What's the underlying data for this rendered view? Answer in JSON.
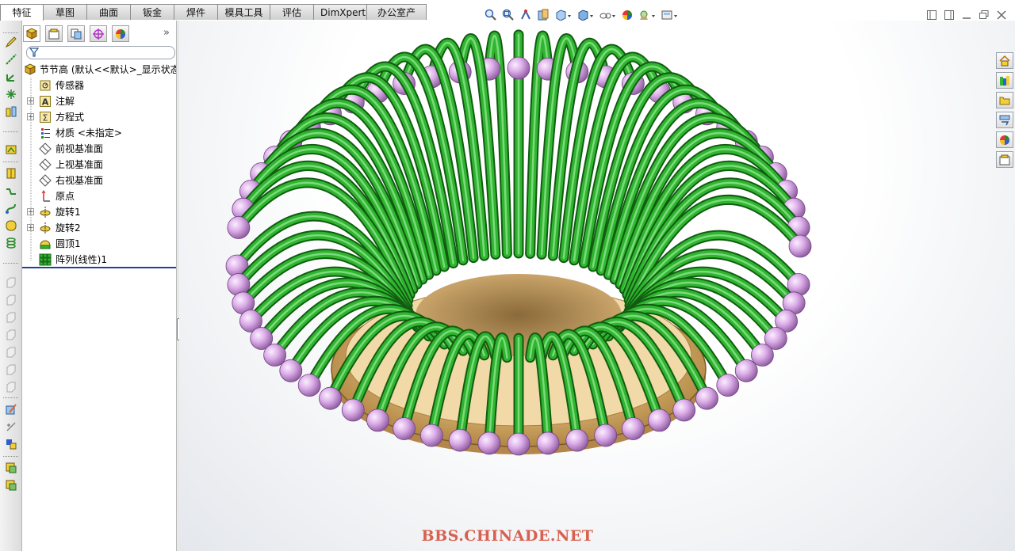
{
  "command_tabs": [
    {
      "label": "特征",
      "active": true
    },
    {
      "label": "草图",
      "active": false
    },
    {
      "label": "曲面",
      "active": false
    },
    {
      "label": "钣金",
      "active": false
    },
    {
      "label": "焊件",
      "active": false
    },
    {
      "label": "模具工具",
      "active": false
    },
    {
      "label": "评估",
      "active": false
    },
    {
      "label": "DimXpert",
      "active": false
    },
    {
      "label": "办公室产品",
      "active": false
    }
  ],
  "view_toolbar": [
    "zoom-to-fit-icon",
    "zoom-to-area-icon",
    "previous-view-icon",
    "section-view-icon",
    "view-orientation-icon",
    "display-style-icon",
    "hide-show-items-icon",
    "edit-appearance-icon",
    "apply-scene-icon",
    "view-settings-icon"
  ],
  "window_controls": {
    "minimize": "▭",
    "tile": "◫",
    "restore": "❐",
    "close": "✕"
  },
  "feature_manager": {
    "panel_tabs": [
      "feature-manager-icon",
      "property-manager-icon",
      "configuration-manager-icon",
      "dimxpert-manager-icon",
      "display-manager-icon"
    ],
    "expand_arrow": "»",
    "tree": [
      {
        "label": "节节高 (默认<<默认>_显示状态",
        "icon": "part-icon",
        "expandable": false
      },
      {
        "label": "传感器",
        "icon": "sensor-icon",
        "expandable": false
      },
      {
        "label": "注解",
        "icon": "annotations-icon",
        "expandable": true
      },
      {
        "label": "方程式",
        "icon": "equations-icon",
        "expandable": true
      },
      {
        "label": "材质 <未指定>",
        "icon": "material-icon",
        "expandable": false
      },
      {
        "label": "前视基准面",
        "icon": "plane-icon",
        "expandable": false
      },
      {
        "label": "上视基准面",
        "icon": "plane-icon",
        "expandable": false
      },
      {
        "label": "右视基准面",
        "icon": "plane-icon",
        "expandable": false
      },
      {
        "label": "原点",
        "icon": "origin-icon",
        "expandable": false
      },
      {
        "label": "旋转1",
        "icon": "revolve-icon",
        "expandable": true
      },
      {
        "label": "旋转2",
        "icon": "revolve-icon",
        "expandable": true
      },
      {
        "label": "圆顶1",
        "icon": "dome-icon",
        "expandable": false
      },
      {
        "label": "阵列(线性)1",
        "icon": "linear-pattern-icon",
        "expandable": false
      }
    ]
  },
  "colors": {
    "tube": "#2fb52f",
    "ball": "#d8a8e6",
    "base": "#e8c27a",
    "highlight": "#1f3fa0"
  },
  "watermark": "BBS.CHINADE.NET"
}
